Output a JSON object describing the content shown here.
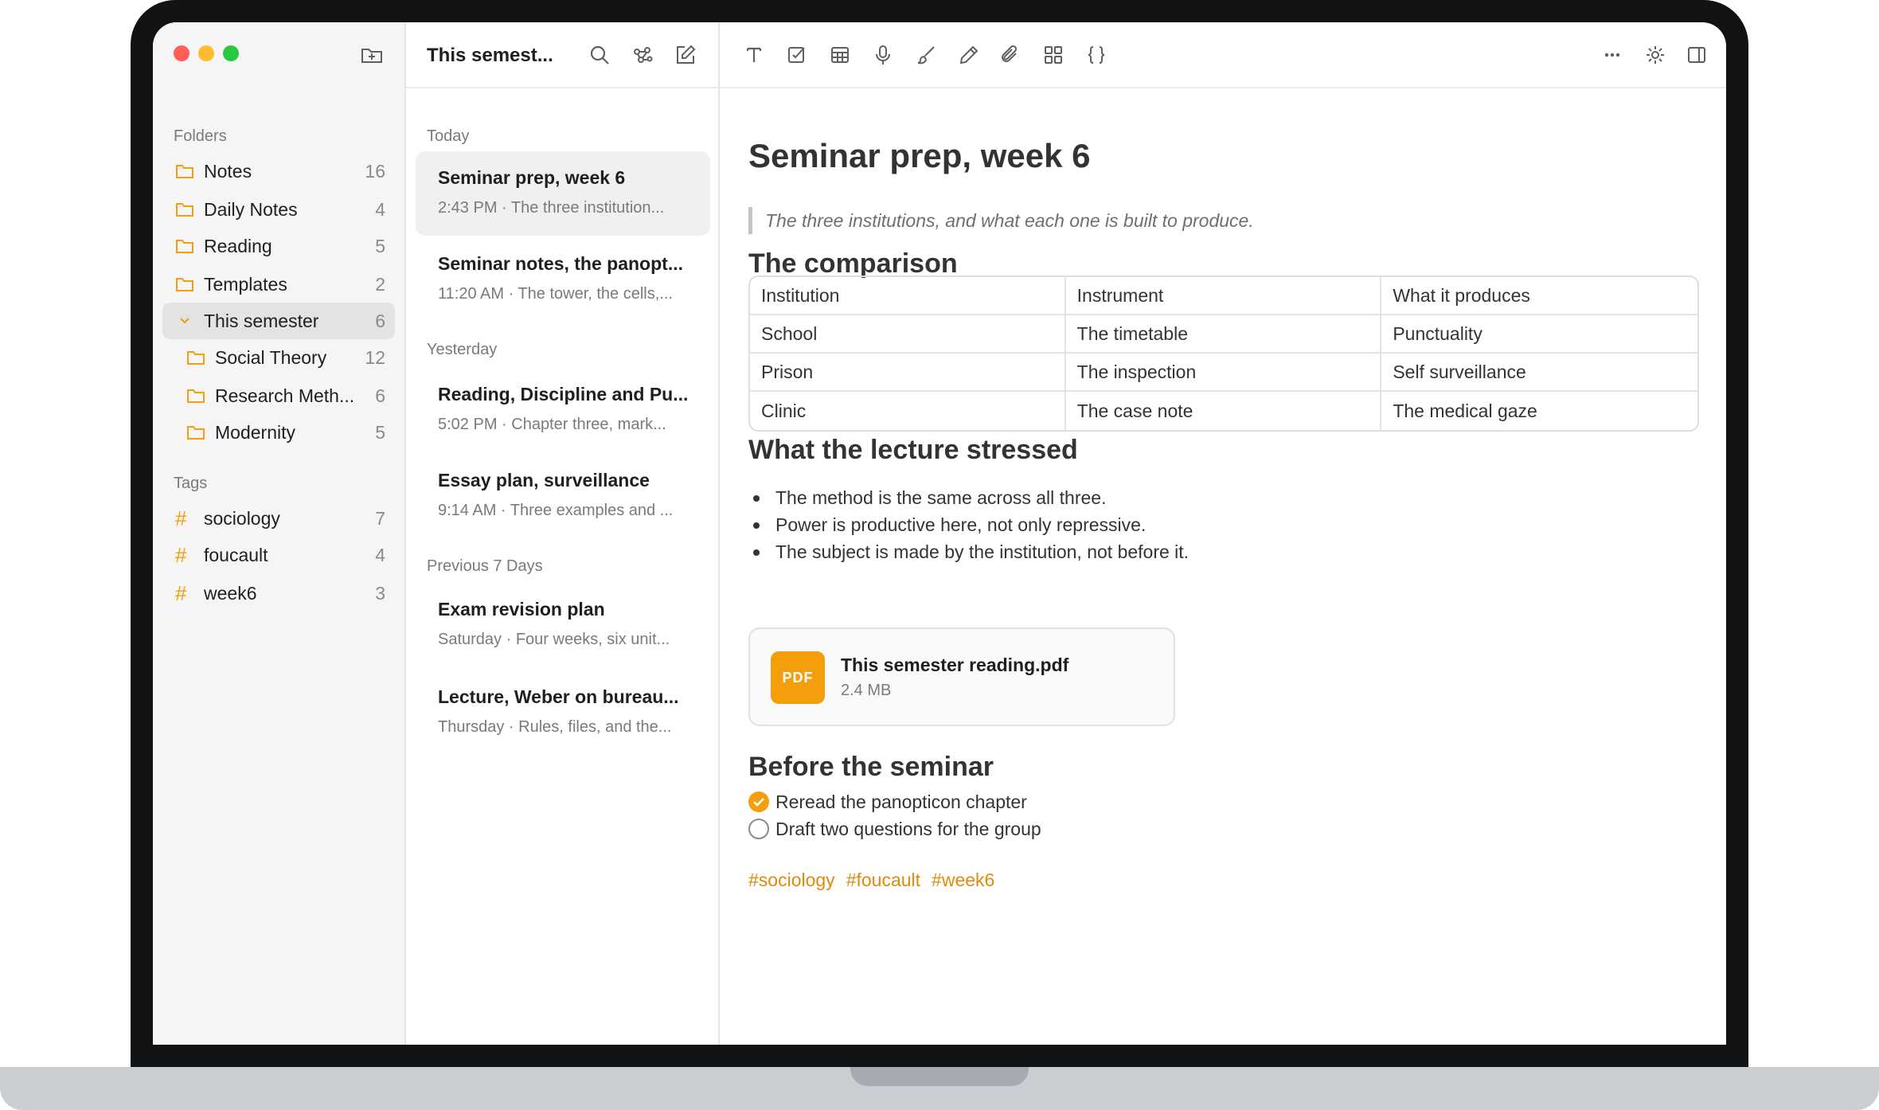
{
  "sidebar": {
    "folders_heading": "Folders",
    "folders": [
      {
        "label": "Notes",
        "count": "16"
      },
      {
        "label": "Daily Notes",
        "count": "4"
      },
      {
        "label": "Reading",
        "count": "5"
      },
      {
        "label": "Templates",
        "count": "2"
      },
      {
        "label": "This semester",
        "count": "6"
      },
      {
        "label": "Social Theory",
        "count": "12"
      },
      {
        "label": "Research Meth...",
        "count": "6"
      },
      {
        "label": "Modernity",
        "count": "5"
      }
    ],
    "tags_heading": "Tags",
    "tags": [
      {
        "label": "sociology",
        "count": "7"
      },
      {
        "label": "foucault",
        "count": "4"
      },
      {
        "label": "week6",
        "count": "3"
      }
    ],
    "icons": {
      "folder": "folder-icon",
      "chevron": "chevron-down-icon",
      "new_folder": "new-folder-icon",
      "hash": "#"
    }
  },
  "note_list": {
    "title": "This semest...",
    "sections": {
      "today": "Today",
      "yesterday": "Yesterday",
      "prev7": "Previous 7 Days"
    },
    "notes": [
      {
        "title": "Seminar prep, week 6",
        "snippet": "2:43 PM · The three institution..."
      },
      {
        "title": "Seminar notes, the panopt...",
        "snippet": "11:20 AM · The tower, the cells,..."
      },
      {
        "title": "Reading, Discipline and Pu...",
        "snippet": "5:02 PM · Chapter three, mark..."
      },
      {
        "title": "Essay plan, surveillance",
        "snippet": "9:14 AM · Three examples and ..."
      },
      {
        "title": "Exam revision plan",
        "snippet": "Saturday · Four weeks, six unit..."
      },
      {
        "title": "Lecture, Weber on bureau...",
        "snippet": "Thursday · Rules, files, and the..."
      }
    ]
  },
  "editor": {
    "title": "Seminar prep, week 6",
    "quote": "The three institutions, and what each one is built to produce.",
    "h_comparison": "The comparison",
    "table": [
      [
        "Institution",
        "Instrument",
        "What it produces"
      ],
      [
        "School",
        "The timetable",
        "Punctuality"
      ],
      [
        "Prison",
        "The inspection",
        "Self surveillance"
      ],
      [
        "Clinic",
        "The case note",
        "The medical gaze"
      ]
    ],
    "h_lecture": "What the lecture stressed",
    "bullets": [
      "The method is the same across all three.",
      "Power is productive here, not only repressive.",
      "The subject is made by the institution, not before it."
    ],
    "attachment": {
      "badge": "PDF",
      "name": "This semester reading.pdf",
      "size": "2.4 MB"
    },
    "h_before": "Before the seminar",
    "tasks": [
      {
        "label": "Reread the panopticon chapter",
        "done": true
      },
      {
        "label": "Draft two questions for the group",
        "done": false
      }
    ],
    "tags": [
      "#sociology",
      "#foucault",
      "#week6"
    ]
  },
  "colors": {
    "accent": "#f59e0b",
    "tag_text": "#e08a0c",
    "close": "#ff5f57",
    "minimize": "#febc2e",
    "zoom": "#28c840"
  }
}
